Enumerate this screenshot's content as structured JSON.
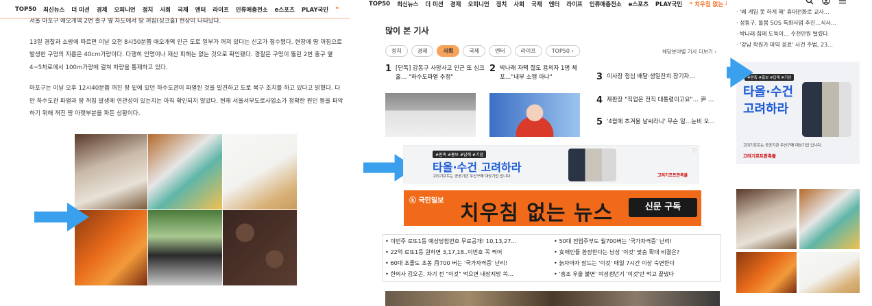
{
  "left": {
    "nav": [
      "TOP50",
      "최신뉴스",
      "더 미션",
      "경제",
      "오피니언",
      "정치",
      "사회",
      "국제",
      "엔터",
      "라이프",
      "인류애충전소",
      "e스포츠",
      "PLAY국민"
    ],
    "nav_quote": "❝ ",
    "paragraphs": [
      "서울 마포구 애오개역 2번 출구 옆 차도에서 땅 꺼짐(싱크홀) 현상이 나타났다.",
      "13일 경찰과 소방에 따르면 이날 오전 8시50분쯤 애오개역 인근 도로 일부가 꺼져 있다는 신고가 접수됐다. 현장에 땅 꺼짐으로 발생한 구멍의 지름은 40cm가량이다. 다행히 인명이나 재산 피해는 없는 것으로 확인됐다. 경찰은 구멍이 뚫린 2번 출구 옆 4~5차로에서 100m가량에 걸쳐 차량을 통제하고 있다.",
      "마포구는 이날 오후 12시40분쯤 꺼진 땅 밑에 있던 하수도관이 파열된 것을 발견하고 도로 복구 조치를 하고 있다고 밝혔다. 다만 하수도관 파열과 땅 꺼짐 발생에 연관성이 있는지는 아직 확인되지 않았다. 현재 서울서부도로사업소가 정확한 원인 등을 파악하기 위해 꺼진 땅 아랫부분을 파둔 상황이다."
    ]
  },
  "mid": {
    "nav": [
      "TOP50",
      "최신뉴스",
      "더 미션",
      "경제",
      "오피니언",
      "정치",
      "사회",
      "국제",
      "엔터",
      "라이프",
      "인류애충전소",
      "e스포츠",
      "PLAY국민"
    ],
    "nav_quote": "❝ 치우침 없는 뉴스 ❞",
    "popular_title": "많이 본 기사",
    "filters": [
      "정치",
      "경제",
      "사회",
      "국제",
      "엔터",
      "라이프",
      "TOP50 ›"
    ],
    "active_filter": "사회",
    "more_link": "해당분야별 기사 더보기 ›",
    "ranks": [
      {
        "num": "1",
        "text": "[단독] 강동구 사망사고 인근 또 싱크홀… \"하수도파열 추정\""
      },
      {
        "num": "2",
        "text": "박나래 자택 절도 용의자 1명 체포…\"내부 소행 아냐\""
      },
      {
        "num": "3",
        "text": "이사장 점심 배달·생일잔치 장기자…"
      },
      {
        "num": "4",
        "text": "재판장 \"직업은 전직 대통령이고요\"… 尹 …"
      },
      {
        "num": "5",
        "text": "'4월에 초겨울 날씨라니' 무슨 일…눈비 오…"
      }
    ],
    "ad": {
      "tags": "#판촉 #홍보 #답례 #기념",
      "headline": "타올·수건 고려하라",
      "sub": "고려기프트는 공공기관 우선구매 대상기업 입니다.",
      "brand": "고려기프트판촉몰",
      "close": "ⓘ"
    },
    "kuk": {
      "logo": "ⓚ 국민일보",
      "headline": "치우침 없는 뉴스",
      "button": "신문 구독"
    },
    "news_list": [
      "이번주 로또1등 예상당첨번호 무료공개! 10,13,27…",
      "50대 전업주부도 월700버는 '국가자격증' 난리!",
      "22억 로또1등 원하면 3,17,18..이번호 꼭 찍어",
      "女애인들 환장한다는 남성 '이것' 맞춤 확대 비결은?",
      "60대 초졸도 초봉 月700 버는 '국가자격증' 난리!",
      "늙자마자 잠드는 '이것' 매일 7시간 이상 숙면한다",
      "한의사 김오곤, 자기 전 \"이것\" 먹으면 내장지방 쏙…",
      "'흥조 우울 불면' 여성갱년기 '이것'만 먹고 끝냈다"
    ]
  },
  "right": {
    "side_list": [
      "'왜 게임 못 하게 해' 휴대전화로 교사…",
      "성동구, 돌봄 SOS 특화사업 추진…식사…",
      "박나래 집에 도둑이… 수천만원 털렸다",
      "'강남 학원가 마약 음료' 사건 주범, 23…"
    ],
    "ad": {
      "tags": "#판촉 #홍보 #답례 #기념",
      "headline_line1": "타올·수건",
      "headline_line2": "고려하라",
      "sub": "고려기프트는 공공기관 우선구매 대상기업 입니다.",
      "brand": "고려기프트판촉몰"
    },
    "icons": [
      "search-icon",
      "user-icon",
      "menu-icon"
    ]
  },
  "colors": {
    "accent": "#f26b1d",
    "arrow": "#3aa0ee",
    "ad_blue": "#1b5ad6",
    "active_chip": "#f7a35a"
  }
}
